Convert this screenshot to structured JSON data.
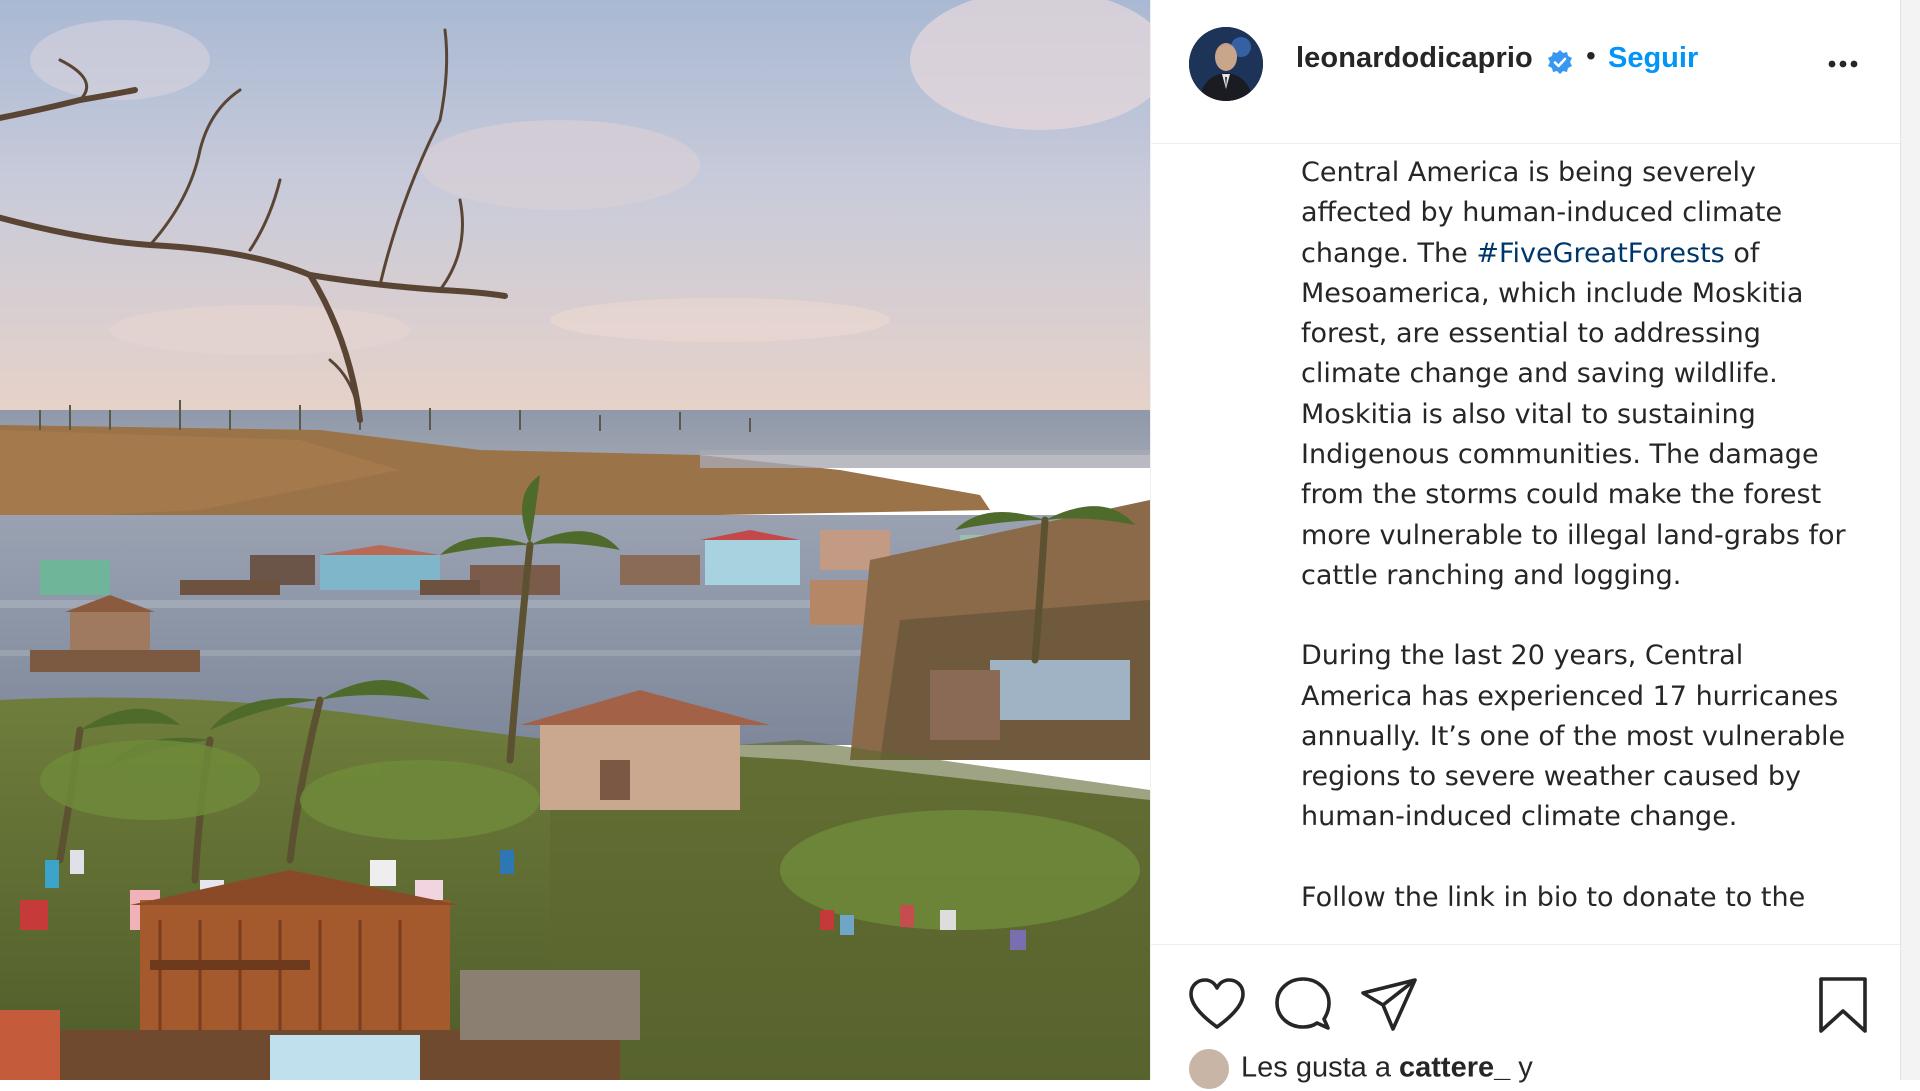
{
  "post": {
    "header": {
      "username": "leonardodicaprio",
      "separator": "•",
      "follow_label": "Seguir",
      "verified_icon": "verified-badge-icon",
      "more_icon": "more-options-icon"
    },
    "caption": {
      "p1_part1": "Central America is being severely affected by human-induced climate change. The ",
      "hashtag": "#FiveGreatForests",
      "p1_part2": " of Mesoamerica, which include Moskitia forest, are essential to addressing climate change and saving wildlife. Moskitia is also vital to sustaining Indigenous communities. The damage from the storms could make the forest more vulnerable to illegal land-grabs for cattle ranching and logging.",
      "p2": "During the last 20 years, Central America has experienced 17 hurricanes annually. It’s one of the most vulnerable regions to severe weather caused by human-induced climate change.",
      "p3": "Follow the link in bio to donate to the"
    },
    "actions": {
      "like_icon": "heart-icon",
      "comment_icon": "comment-bubble-icon",
      "share_icon": "paper-plane-icon",
      "save_icon": "bookmark-icon"
    },
    "likes": {
      "prefix": "Les gusta a ",
      "user": "cattere_",
      "suffix": " y"
    }
  },
  "colors": {
    "link_blue": "#0095f6",
    "hashtag_blue": "#00376b",
    "text": "#262626",
    "divider": "#efefef"
  }
}
